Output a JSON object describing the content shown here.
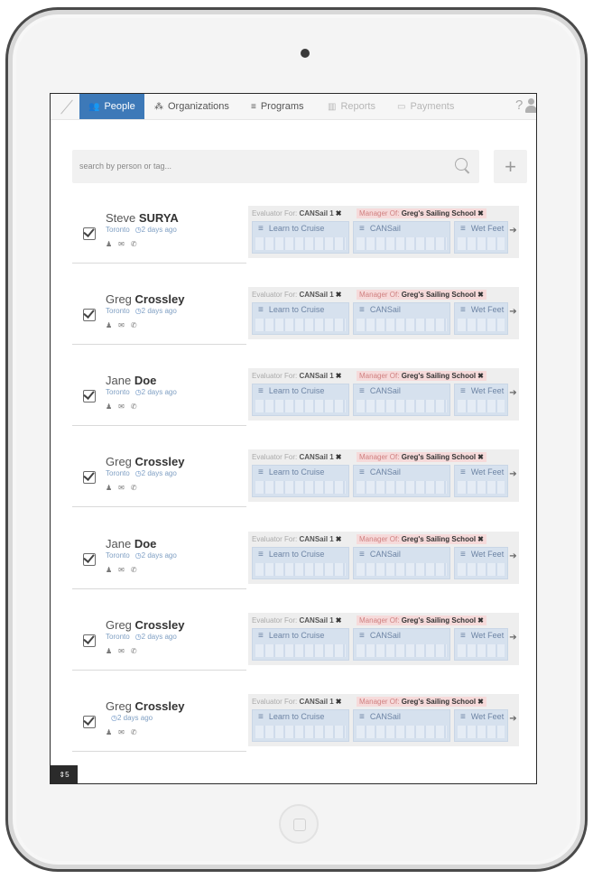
{
  "nav": {
    "tabs": [
      {
        "label": "People",
        "icon": "people-icon"
      },
      {
        "label": "Organizations",
        "icon": "organization-icon"
      },
      {
        "label": "Programs",
        "icon": "list-icon"
      },
      {
        "label": "Reports",
        "icon": "bar-chart-icon"
      },
      {
        "label": "Payments",
        "icon": "credit-card-icon"
      }
    ],
    "help": "?"
  },
  "search": {
    "placeholder": "search by person or tag..."
  },
  "add_button": "+",
  "people": [
    {
      "first": "Steve",
      "last": "SURYA",
      "location": "Toronto",
      "time": "2 days ago"
    },
    {
      "first": "Greg",
      "last": "Crossley",
      "location": "Toronto",
      "time": "2 days ago"
    },
    {
      "first": "Jane",
      "last": "Doe",
      "location": "Toronto",
      "time": "2 days ago"
    },
    {
      "first": "Greg",
      "last": "Crossley",
      "location": "Toronto",
      "time": "2 days ago"
    },
    {
      "first": "Jane",
      "last": "Doe",
      "location": "Toronto",
      "time": "2 days ago"
    },
    {
      "first": "Greg",
      "last": "Crossley",
      "location": "Toronto",
      "time": "2 days ago"
    },
    {
      "first": "Greg",
      "last": "Crossley",
      "location": "",
      "time": "2 days ago"
    }
  ],
  "tags": {
    "evaluator_prefix": "Evaluator For:",
    "evaluator_value": "CANSail 1",
    "manager_prefix": "Manager Of:",
    "manager_value": "Greg's Sailing School",
    "remove": "✖"
  },
  "programs": [
    "Learn to Cruise",
    "CANSail",
    "Wet Feet"
  ],
  "footer": {
    "badge": "⇕5"
  },
  "colors": {
    "accent": "#3d79b8",
    "tag_manager_bg": "#f6dada",
    "program_bg": "#d6e1ee"
  }
}
